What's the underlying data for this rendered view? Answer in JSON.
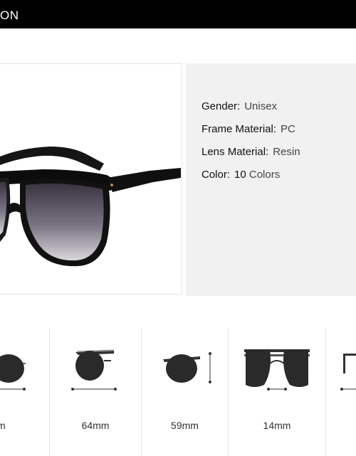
{
  "header": {
    "title": "ON"
  },
  "product": {
    "image": "black-flat-top-sunglasses-gradient-lens"
  },
  "specs": [
    {
      "label": "Gender:",
      "value": "Unisex"
    },
    {
      "label": "Frame Material:",
      "value": "PC"
    },
    {
      "label": "Lens Material:",
      "value": "Resin"
    },
    {
      "label": "Color:",
      "value_num": "10",
      "value": "Colors"
    }
  ],
  "dimensions": [
    {
      "icon": "lens-width-icon",
      "value": "m"
    },
    {
      "icon": "frame-width-icon",
      "value": "64mm"
    },
    {
      "icon": "lens-height-icon",
      "value": "59mm"
    },
    {
      "icon": "bridge-width-icon",
      "value": "14mm"
    },
    {
      "icon": "temple-length-icon",
      "value": ""
    }
  ],
  "colors": {
    "header_bg": "#000000",
    "specs_bg": "#f1f1f1",
    "text": "#222222"
  }
}
